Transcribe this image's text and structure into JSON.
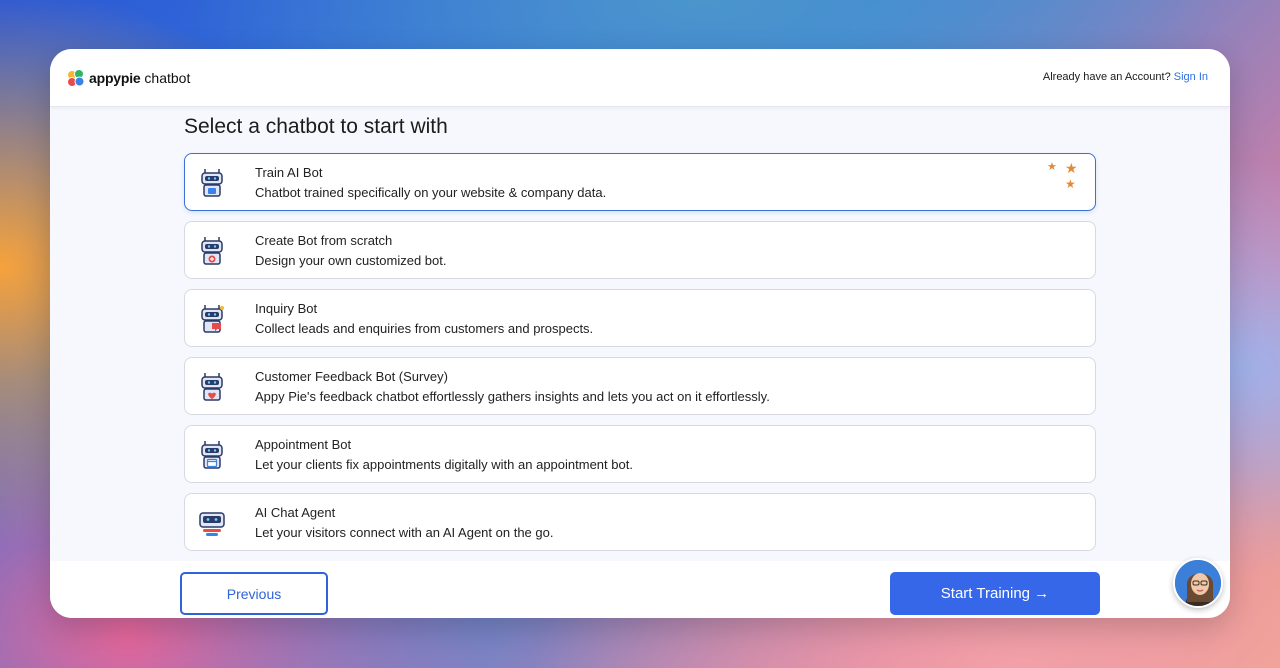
{
  "header": {
    "logo_bold": "appypie",
    "logo_light": " chatbot",
    "account_prompt": "Already have an Account?",
    "sign_in": "Sign In"
  },
  "page_title": "Select a chatbot to start with",
  "bots": [
    {
      "name": "Train AI Bot",
      "description": "Chatbot trained specifically on your website & company data."
    },
    {
      "name": "Create Bot from scratch",
      "description": "Design your own customized bot."
    },
    {
      "name": "Inquiry Bot",
      "description": "Collect leads and enquiries from customers and prospects."
    },
    {
      "name": "Customer Feedback Bot (Survey)",
      "description": "Appy Pie's feedback chatbot effortlessly gathers insights and lets you act on it effortlessly."
    },
    {
      "name": "Appointment Bot",
      "description": "Let your clients fix appointments digitally with an appointment bot."
    },
    {
      "name": "AI Chat Agent",
      "description": "Let your visitors connect with an AI Agent on the go."
    }
  ],
  "selected_bot": "Train AI Bot",
  "footer": {
    "previous_label": "Previous",
    "start_label": "Start Training →"
  },
  "colors": {
    "accent": "#3567e8",
    "selected_border": "#3e6fd6",
    "stars": "#e18b3a",
    "link": "#2f6fe0"
  },
  "icons": {
    "bot": "robot-icon",
    "stars": "sparkle-stars-icon",
    "arrow": "arrow-right-icon"
  }
}
